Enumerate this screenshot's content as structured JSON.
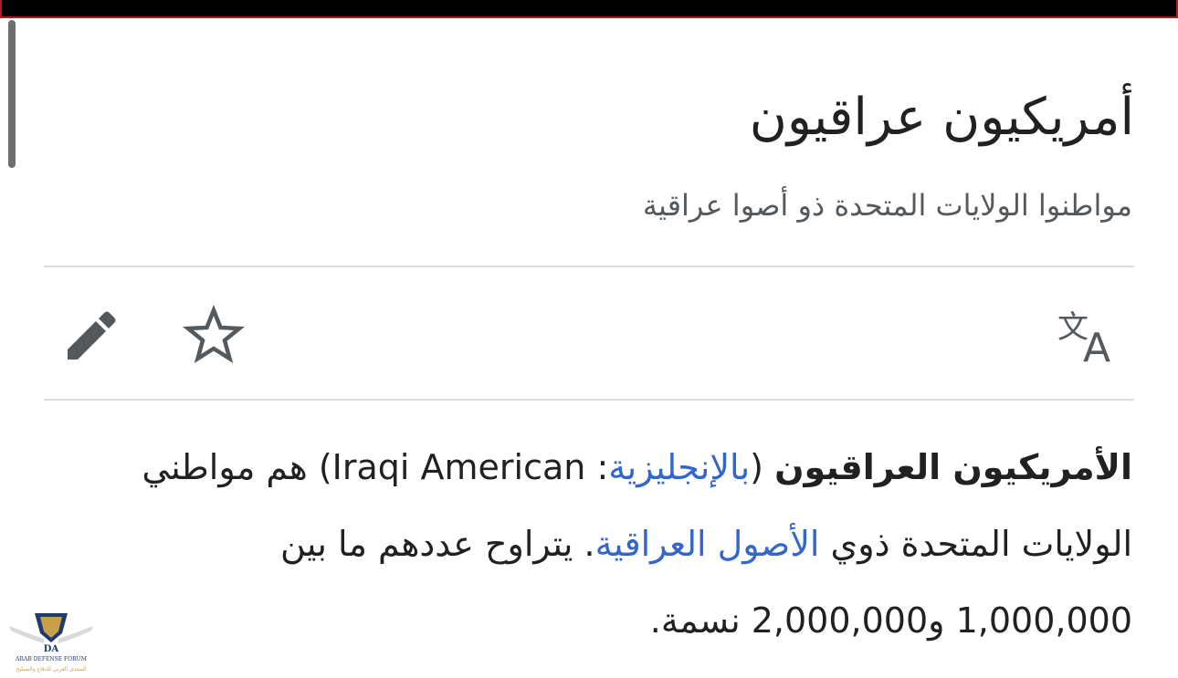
{
  "page": {
    "title": "أمريكيون عراقيون",
    "description": "مواطنوا الولايات المتحدة ذو أصوا عراقية"
  },
  "actions": {
    "edit_icon": "pencil-icon",
    "watch_icon": "star-icon",
    "language_icon": "translate-icon"
  },
  "lead": {
    "bold_term": "الأمريكيون العراقيون",
    "open_paren": " (",
    "lang_link": "بالإنجليزية",
    "colon": ": ",
    "english_term": "Iraqi American",
    "close_rest": ") هم مواطني الولايات المتحدة ذوي ",
    "origin_link": "الأصول العراقية",
    "rest": ". يتراوح عددهم ما بين 1,000,000 و2,000,000 نسمة."
  },
  "watermark": {
    "initials": "DA",
    "name": "ARAB DEFENSE FORUM",
    "name_ar": "المنتدى العربي للدفاع والتسليح"
  },
  "colors": {
    "link": "#3366cc",
    "text": "#202122",
    "subtle_text": "#54595d",
    "icon": "#54595d",
    "top_bar": "#000000",
    "top_bar_border": "#b21b1f"
  }
}
